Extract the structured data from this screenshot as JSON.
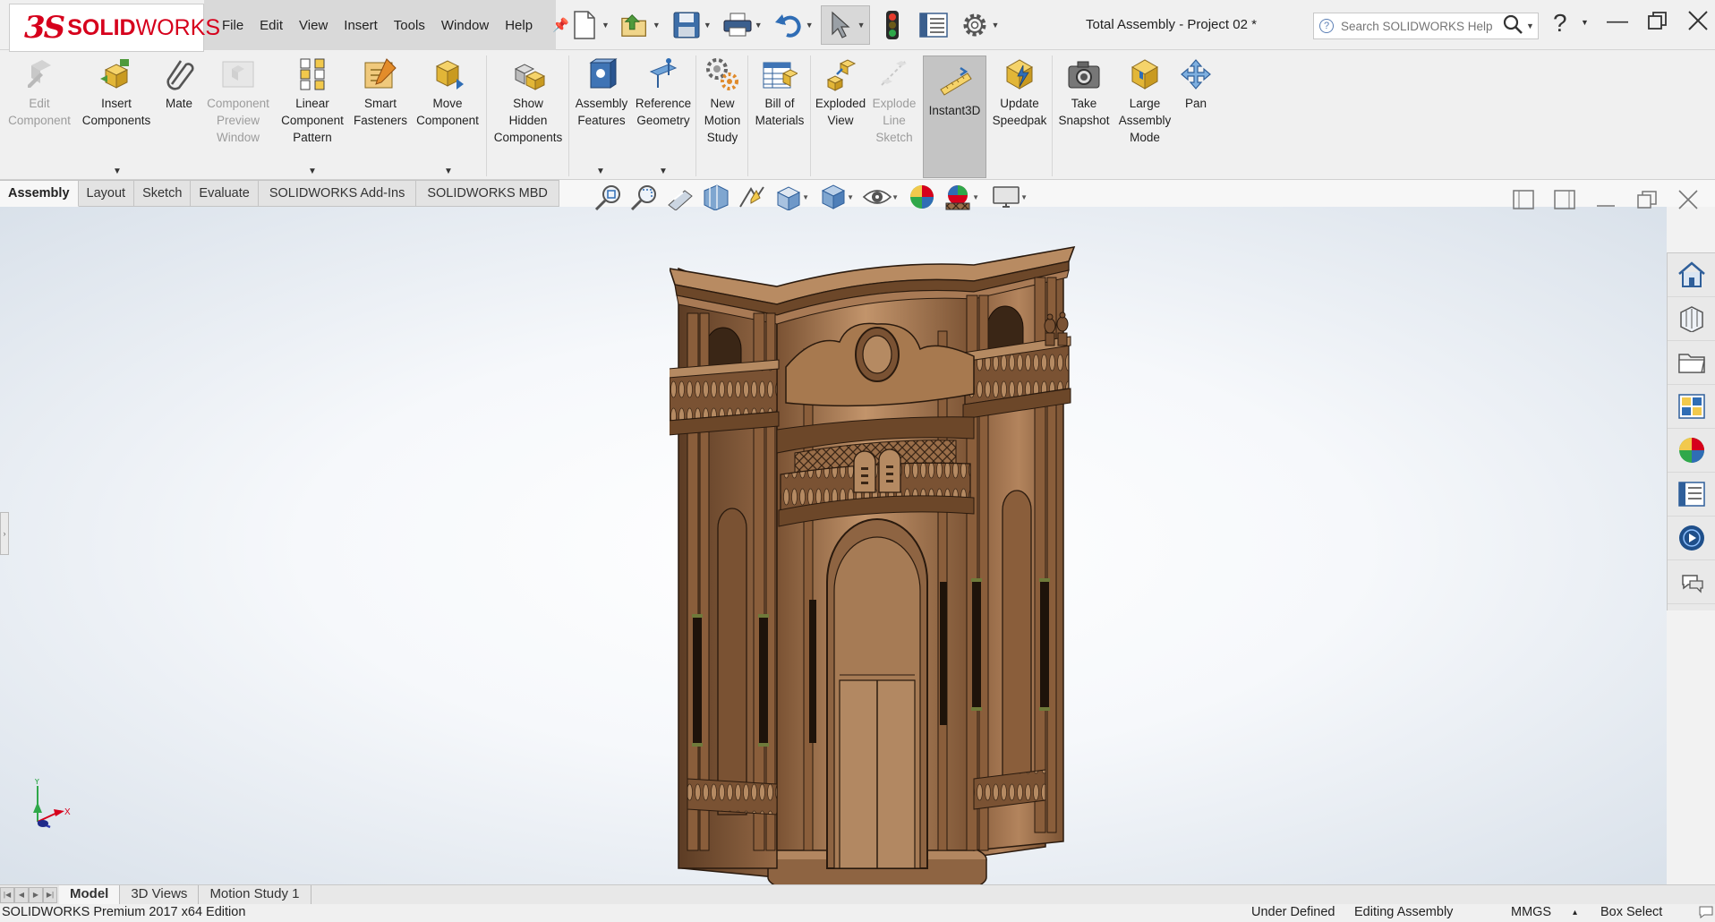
{
  "app": {
    "logo_ds": "3S",
    "logo_solid": "SOLID",
    "logo_works": "WORKS",
    "document_title": "Total Assembly - Project 02 *"
  },
  "menu": [
    "File",
    "Edit",
    "View",
    "Insert",
    "Tools",
    "Window",
    "Help"
  ],
  "search": {
    "placeholder": "Search SOLIDWORKS Help"
  },
  "toolbar": {
    "tools": [
      {
        "label": "Edit\nComponent",
        "icon": "edit-component-icon",
        "enabled": false
      },
      {
        "label": "Insert\nComponents",
        "icon": "insert-components-icon",
        "enabled": true
      },
      {
        "label": "Mate",
        "icon": "mate-paperclip-icon",
        "enabled": true
      },
      {
        "label": "Component\nPreview\nWindow",
        "icon": "component-preview-icon",
        "enabled": false
      },
      {
        "label": "Linear\nComponent\nPattern",
        "icon": "linear-pattern-icon",
        "enabled": true
      },
      {
        "label": "Smart\nFasteners",
        "icon": "smart-fasteners-icon",
        "enabled": true
      },
      {
        "label": "Move\nComponent",
        "icon": "move-component-icon",
        "enabled": true
      },
      {
        "label": "Show\nHidden\nComponents",
        "icon": "show-hidden-icon",
        "enabled": true
      },
      {
        "label": "Assembly\nFeatures",
        "icon": "assembly-features-icon",
        "enabled": true
      },
      {
        "label": "Reference\nGeometry",
        "icon": "reference-geometry-icon",
        "enabled": true
      },
      {
        "label": "New\nMotion\nStudy",
        "icon": "motion-study-icon",
        "enabled": true
      },
      {
        "label": "Bill of\nMaterials",
        "icon": "bill-of-materials-icon",
        "enabled": true
      },
      {
        "label": "Exploded\nView",
        "icon": "exploded-view-icon",
        "enabled": true
      },
      {
        "label": "Explode\nLine\nSketch",
        "icon": "explode-line-sketch-icon",
        "enabled": false
      },
      {
        "label": "Instant3D",
        "icon": "instant3d-icon",
        "enabled": true,
        "active": true
      },
      {
        "label": "Update\nSpeedpak",
        "icon": "speedpak-icon",
        "enabled": true
      },
      {
        "label": "Take\nSnapshot",
        "icon": "camera-icon",
        "enabled": true
      },
      {
        "label": "Large\nAssembly\nMode",
        "icon": "large-assembly-icon",
        "enabled": true
      },
      {
        "label": "Pan",
        "icon": "pan-icon",
        "enabled": true
      }
    ]
  },
  "cm_tabs": [
    "Assembly",
    "Layout",
    "Sketch",
    "Evaluate",
    "SOLIDWORKS Add-Ins",
    "SOLIDWORKS MBD"
  ],
  "bottom_tabs": [
    "Model",
    "3D Views",
    "Motion Study 1"
  ],
  "triad": {
    "y": "Y",
    "x": "X"
  },
  "status": {
    "edition": "SOLIDWORKS Premium 2017 x64 Edition",
    "definition": "Under Defined",
    "mode": "Editing Assembly",
    "units": "MMGS",
    "units_arrow": "▴",
    "selection": "Box Select"
  },
  "colors": {
    "brand": "#d6001c",
    "model_wood": "#a87a55",
    "model_dark": "#3a2616",
    "accent_blue": "#2f6db5"
  }
}
